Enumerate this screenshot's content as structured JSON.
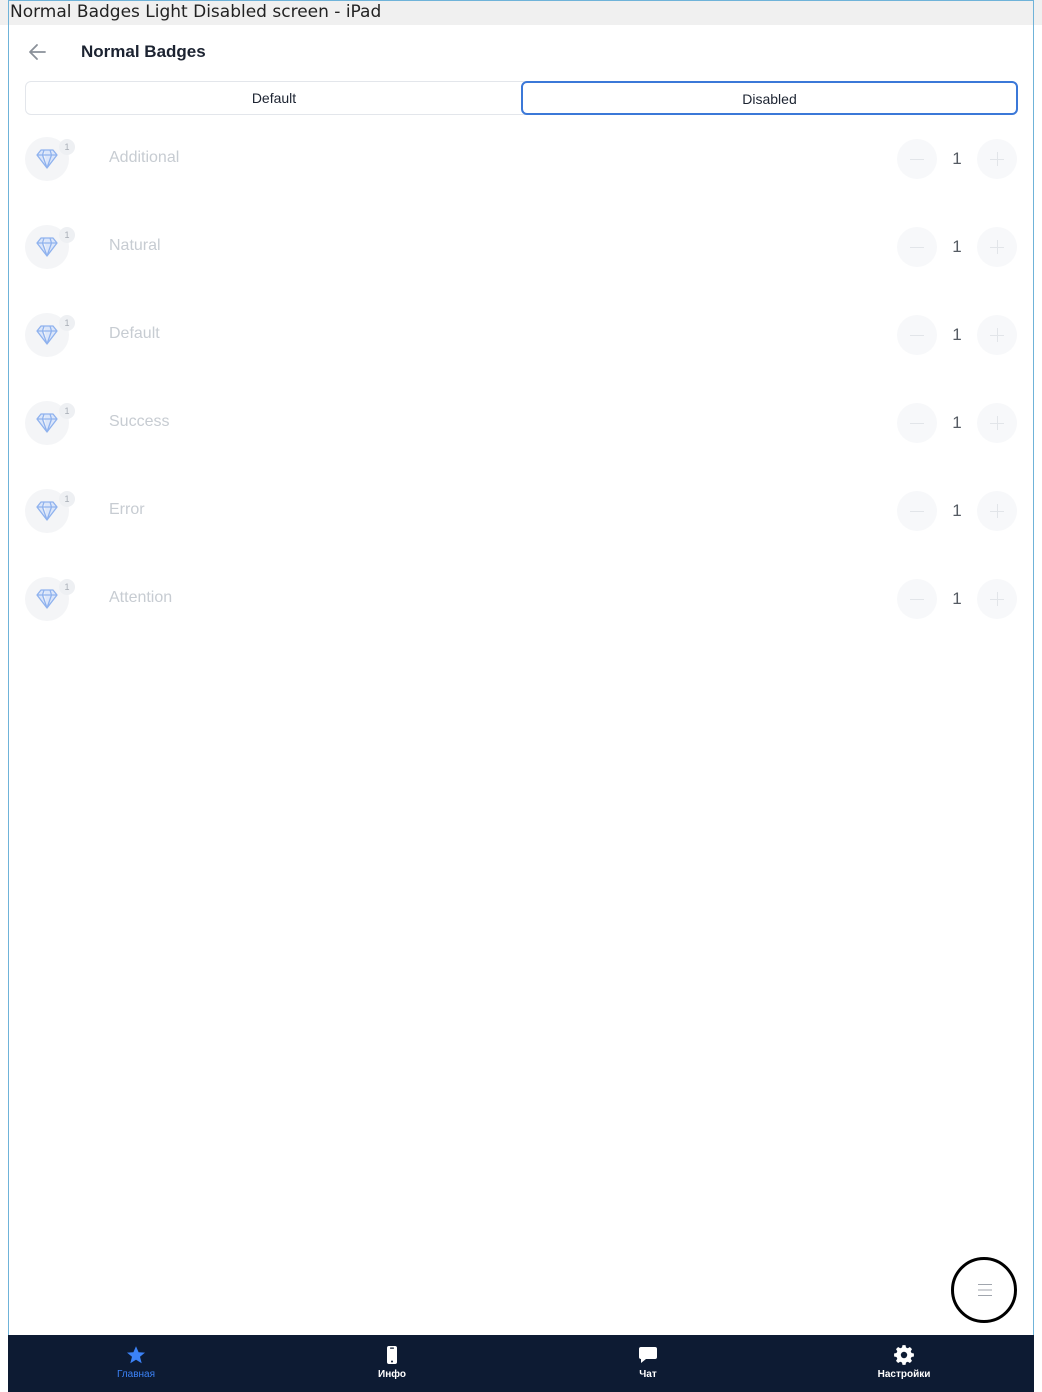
{
  "window": {
    "title": "Normal Badges Light Disabled screen - iPad"
  },
  "header": {
    "title": "Normal Badges"
  },
  "segments": [
    {
      "label": "Default",
      "selected": false
    },
    {
      "label": "Disabled",
      "selected": true
    }
  ],
  "rows": [
    {
      "label": "Additional",
      "badge": "1",
      "value": "1"
    },
    {
      "label": "Natural",
      "badge": "1",
      "value": "1"
    },
    {
      "label": "Default",
      "badge": "1",
      "value": "1"
    },
    {
      "label": "Success",
      "badge": "1",
      "value": "1"
    },
    {
      "label": "Error",
      "badge": "1",
      "value": "1"
    },
    {
      "label": "Attention",
      "badge": "1",
      "value": "1"
    }
  ],
  "tabs": [
    {
      "label": "Главная",
      "icon": "star-icon",
      "active": true
    },
    {
      "label": "Инфо",
      "icon": "phone-icon",
      "active": false
    },
    {
      "label": "Чат",
      "icon": "chat-bubble-icon",
      "active": false
    },
    {
      "label": "Настройки",
      "icon": "gear-icon",
      "active": false
    }
  ],
  "colors": {
    "accent": "#3b78d8",
    "tabbar": "#0d1b33",
    "active_tab": "#3b82f6",
    "disabled_text": "#c7ccd2",
    "diamond_icon": "#8fb2ee"
  },
  "fab": {
    "icon": "menu-lines-icon"
  }
}
